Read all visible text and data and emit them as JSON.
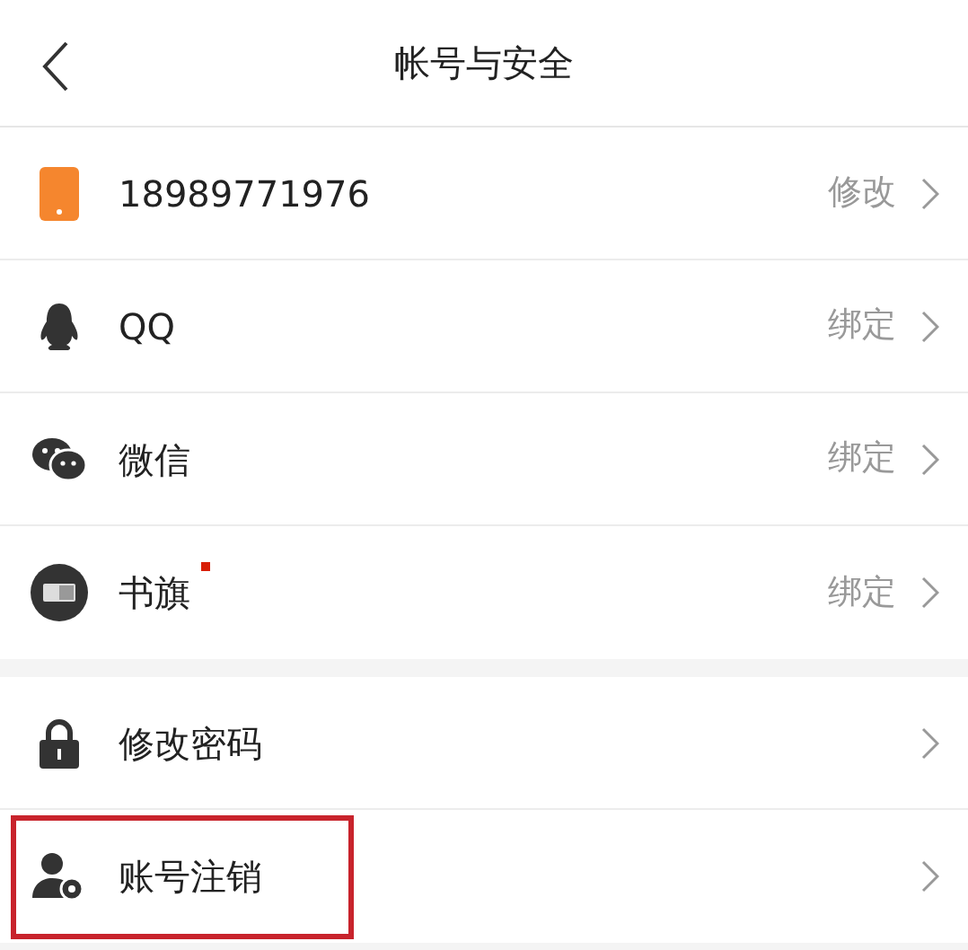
{
  "header": {
    "title": "帐号与安全"
  },
  "sections": [
    {
      "items": [
        {
          "kind": "phone",
          "label": "18989771976",
          "action": "修改",
          "dot": false,
          "highlighted": false
        },
        {
          "kind": "penguin",
          "label": "QQ",
          "action": "绑定",
          "dot": false,
          "highlighted": false
        },
        {
          "kind": "chat",
          "label": "微信",
          "action": "绑定",
          "dot": false,
          "highlighted": false
        },
        {
          "kind": "book",
          "label": "书旗",
          "action": "绑定",
          "dot": true,
          "highlighted": false
        }
      ]
    },
    {
      "items": [
        {
          "kind": "lock",
          "label": "修改密码",
          "dot": false,
          "highlighted": false
        },
        {
          "kind": "user",
          "label": "账号注销",
          "dot": false,
          "highlighted": true
        }
      ]
    }
  ]
}
